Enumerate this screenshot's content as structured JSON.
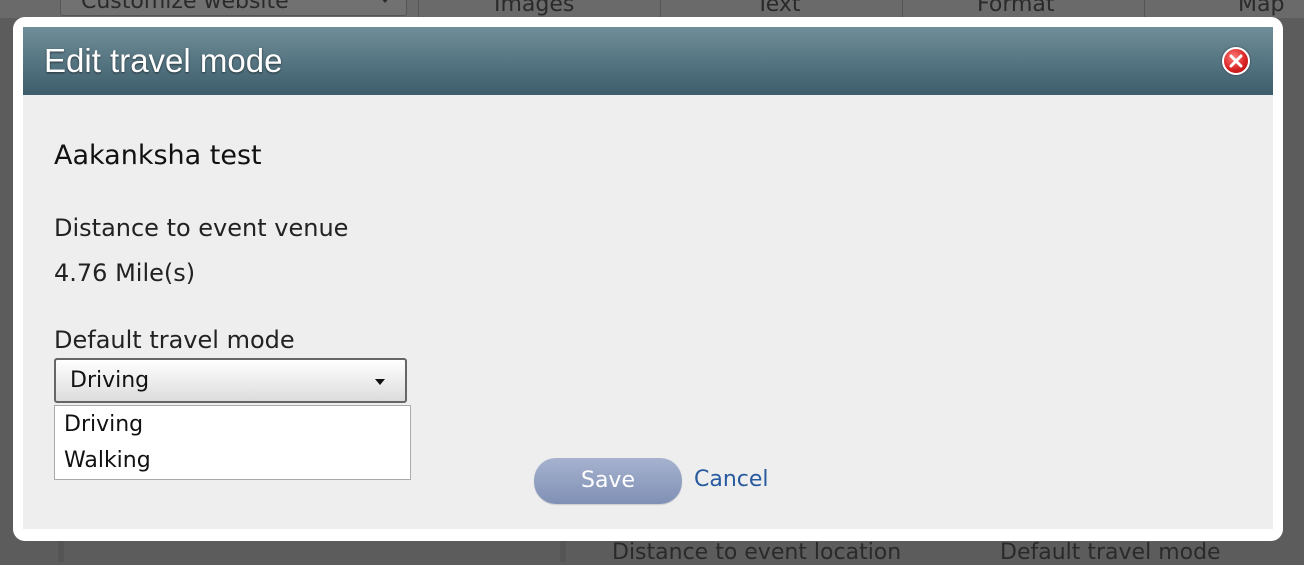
{
  "background": {
    "customize_select": "Customize website",
    "tabs": [
      "Images",
      "Text",
      "Format",
      "Map"
    ],
    "bottom_headers": [
      "Distance to event location",
      "Default travel mode"
    ]
  },
  "dialog": {
    "title": "Edit travel mode",
    "close_icon": "close-icon",
    "name": "Aakanksha test",
    "distance_label": "Distance to event venue",
    "distance_value": "4.76 Mile(s)",
    "mode_label": "Default travel mode",
    "selected_mode": "Driving",
    "options": [
      "Driving",
      "Walking"
    ],
    "save_label": "Save",
    "cancel_label": "Cancel"
  },
  "colors": {
    "title_bar_top": "#6f8e99",
    "title_bar_bottom": "#3d5d6b",
    "close_button": "#d62020",
    "save_button": "#8f9cc0",
    "cancel_link": "#275a9e"
  }
}
